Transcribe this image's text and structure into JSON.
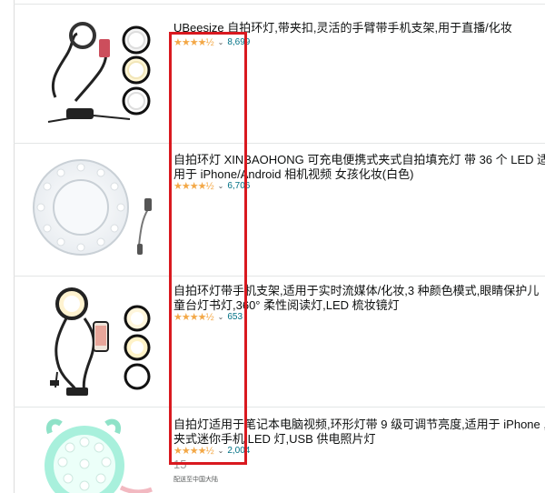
{
  "listings": [
    {
      "title": "UBeesize 自拍环灯,带夹扣,灵活的手臂带手机支架,用于直播/化妆",
      "stars": "★★★★½",
      "count": "8,699"
    },
    {
      "title": "自拍环灯 XINBAOHONG 可充电便携式夹式自拍填充灯 带 36 个 LED 适用于 iPhone/Android 相机视频 女孩化妆(白色)",
      "stars": "★★★★½",
      "count": "6,706"
    },
    {
      "title": "自拍环灯带手机支架,适用于实时流媒体/化妆,3 种颜色模式,眼睛保护儿童台灯书灯,360° 柔性阅读灯,LED 梳妆镜灯",
      "stars": "★★★★½",
      "count": "653"
    },
    {
      "title": "自拍灯适用于笔记本电脑视频,环形灯带 9 级可调节亮度,适用于 iPhone ,夹式迷你手机 LED 灯,USB 供电照片灯",
      "stars": "★★★★½",
      "count": "2,004",
      "price": "15",
      "shipping": "配送至中国大陆"
    }
  ],
  "colors": {
    "highlight": "#d9191f",
    "star": "#f3a847",
    "link": "#007185"
  }
}
